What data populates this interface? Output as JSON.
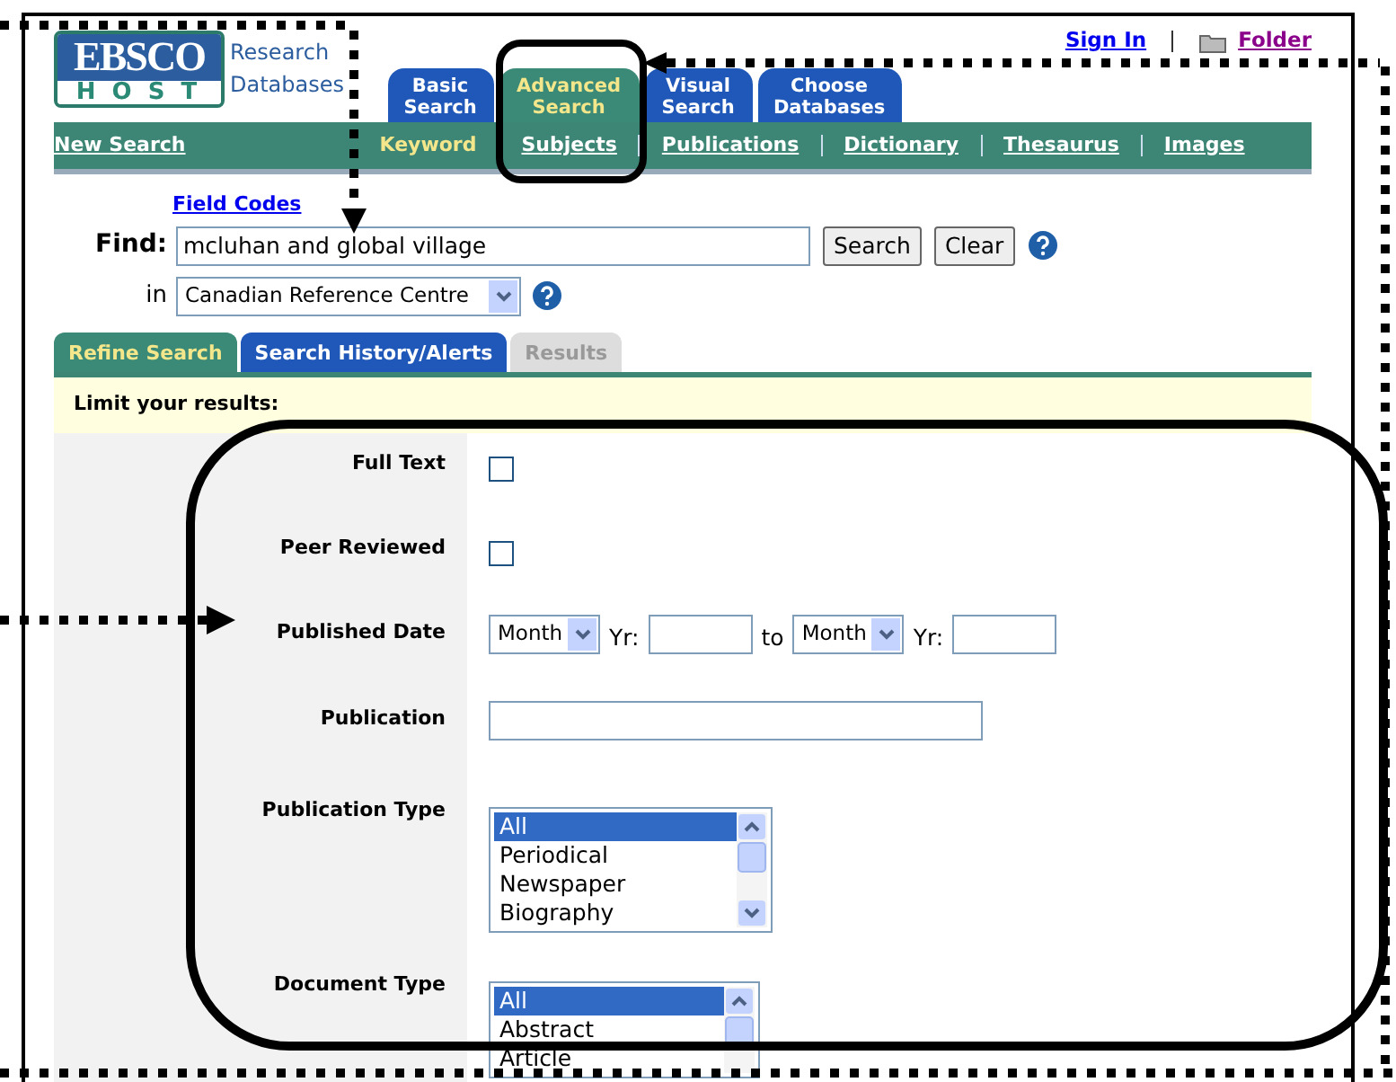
{
  "header": {
    "logo_top": "EBSCO",
    "logo_bottom": "HOST",
    "product_line1": "Research",
    "product_line2": "Databases",
    "user_links": [
      {
        "label": "Sign In",
        "visited": false
      },
      {
        "label": "Folder",
        "visited": true
      }
    ]
  },
  "search_tabs": [
    {
      "label": "Basic Search",
      "selected": false
    },
    {
      "label": "Advanced Search",
      "selected": true
    },
    {
      "label": "Visual Search",
      "selected": false
    },
    {
      "label": "Choose Databases",
      "selected": false
    }
  ],
  "toolbar": {
    "new_search": "New Search",
    "links": [
      {
        "label": "Keyword",
        "selected": true
      },
      {
        "label": "Subjects",
        "selected": false
      },
      {
        "label": "Publications",
        "selected": false
      },
      {
        "label": "Dictionary",
        "selected": false
      },
      {
        "label": "Thesaurus",
        "selected": false
      },
      {
        "label": "Images",
        "selected": false
      }
    ]
  },
  "search": {
    "field_codes": "Field Codes",
    "find_label": "Find:",
    "query": "mcluhan and global village",
    "buttons": [
      "Search",
      "Clear"
    ],
    "in_label": "in",
    "database": "Canadian Reference Centre"
  },
  "result_tabs": [
    {
      "label": "Refine Search",
      "selected": true,
      "disabled": false
    },
    {
      "label": "Search History/Alerts",
      "selected": false,
      "disabled": false
    },
    {
      "label": "Results",
      "selected": false,
      "disabled": true
    }
  ],
  "limit_heading": "Limit your results:",
  "limiters": [
    {
      "kind": "checkbox",
      "label": "Full Text",
      "checked": false
    },
    {
      "kind": "checkbox",
      "label": "Peer Reviewed",
      "checked": false
    },
    {
      "kind": "date",
      "label": "Published Date",
      "month_from": "Month",
      "yr_label": "Yr:",
      "to_label": "to",
      "month_to": "Month",
      "yr_label_2": "Yr:"
    },
    {
      "kind": "text",
      "label": "Publication"
    },
    {
      "kind": "listbox",
      "label": "Publication Type",
      "options": [
        {
          "label": "All",
          "selected": true
        },
        {
          "label": "Periodical",
          "selected": false
        },
        {
          "label": "Newspaper",
          "selected": false
        },
        {
          "label": "Biography",
          "selected": false
        }
      ]
    },
    {
      "kind": "listbox",
      "label": "Document Type",
      "options": [
        {
          "label": "All",
          "selected": true
        },
        {
          "label": "Abstract",
          "selected": false
        },
        {
          "label": "Article",
          "selected": false
        }
      ]
    }
  ]
}
